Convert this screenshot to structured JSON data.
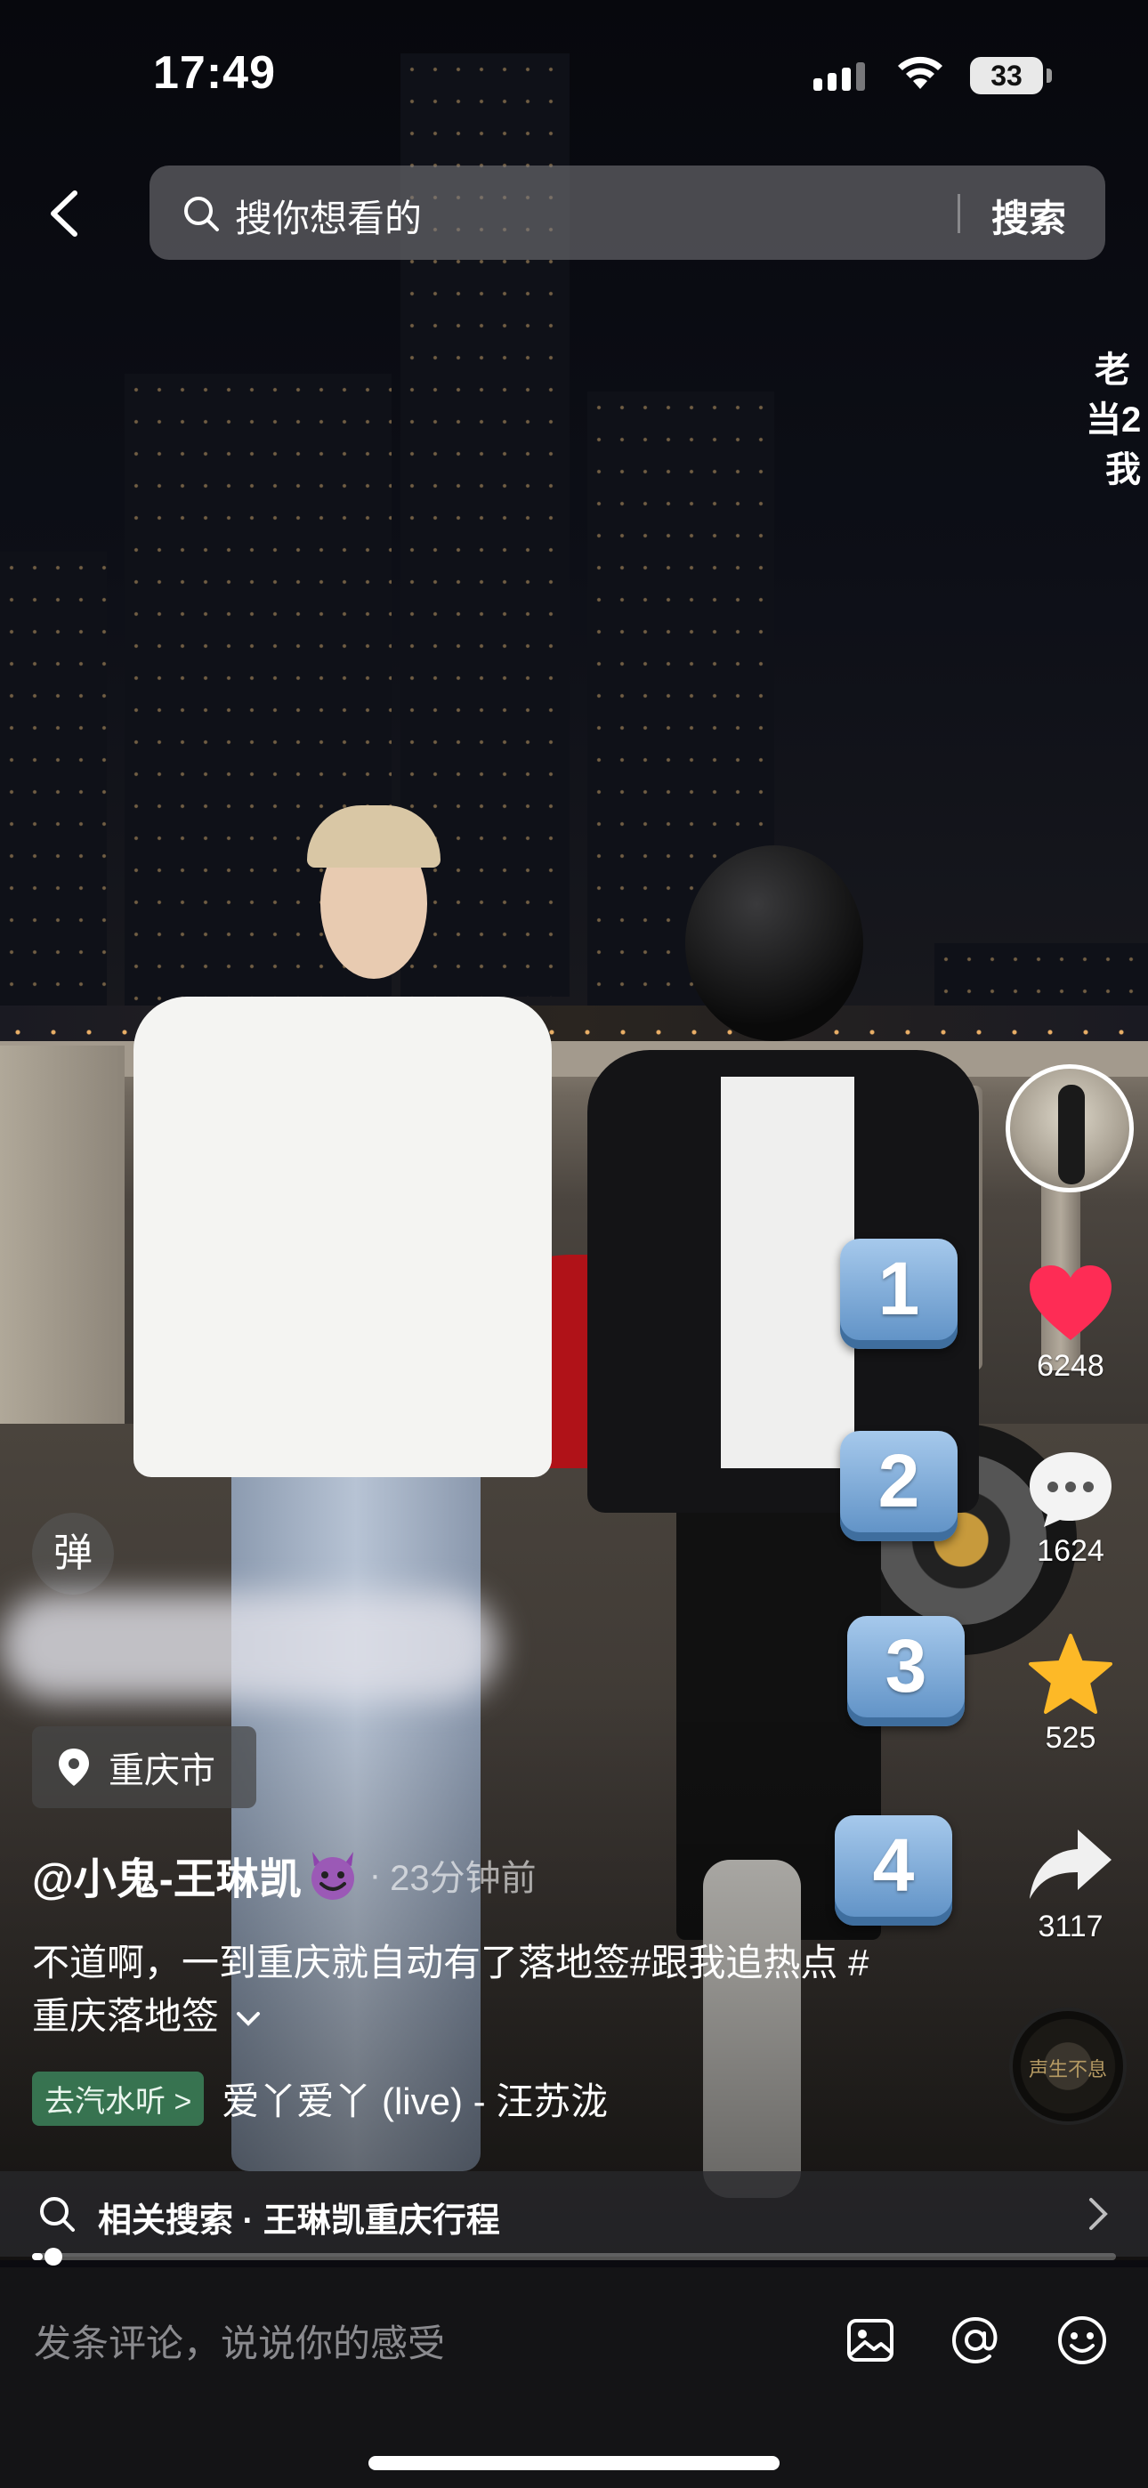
{
  "status_bar": {
    "time": "17:49",
    "battery": "33"
  },
  "search": {
    "placeholder": "搜你想看的",
    "button": "搜索"
  },
  "overlay_text": [
    "老",
    "当2",
    "我"
  ],
  "actions": {
    "like_count": "6248",
    "comment_count": "1624",
    "favorite_count": "525",
    "share_count": "3117"
  },
  "keycaps": [
    "1",
    "2",
    "3",
    "4"
  ],
  "danmu_label": "弹",
  "location": "重庆市",
  "author": "@小鬼-王琳凯",
  "time_ago": "23分钟前",
  "caption": "不道啊，一到重庆就自动有了落地签#跟我追热点 #重庆落地签",
  "music": {
    "tag": "去汽水听 >",
    "title": "爱丫爱丫 (live) - 汪苏泷",
    "disc_text": "声生不息"
  },
  "related_search": "相关搜索 · 王琳凯重庆行程",
  "progress": 0.01,
  "comment_placeholder": "发条评论，说说你的感受",
  "colors": {
    "like": "#fe2c55",
    "favorite": "#fdb927",
    "keycap": "#6a9cd2"
  }
}
